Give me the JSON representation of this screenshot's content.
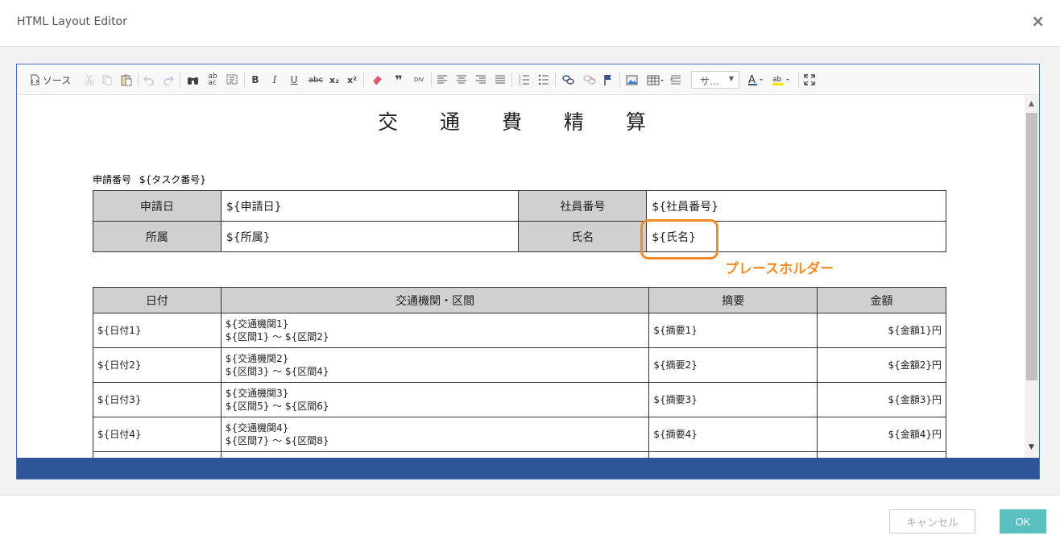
{
  "dialog": {
    "title": "HTML Layout Editor",
    "close_glyph": "×",
    "cancel_label": "キャンセル",
    "ok_label": "OK"
  },
  "colors": {
    "accent_blue": "#2d5597",
    "highlight_orange": "#f28c28",
    "ok_button": "#5bc0c0"
  },
  "toolbar": {
    "source_label": "ソース",
    "format_select_value": "サ…",
    "buttons": [
      "source-button",
      "cut-button",
      "copy-button",
      "paste-button",
      "undo-button",
      "redo-button",
      "find-button",
      "replace-button",
      "select-all-button",
      "bold-button",
      "italic-button",
      "underline-button",
      "strikethrough-button",
      "subscript-button",
      "superscript-button",
      "remove-format-button",
      "blockquote-button",
      "div-button",
      "align-left-button",
      "align-center-button",
      "align-right-button",
      "justify-button",
      "numbered-list-button",
      "bulleted-list-button",
      "link-button",
      "unlink-button",
      "anchor-button",
      "image-button",
      "table-button",
      "hr-button",
      "format-select",
      "text-color-button",
      "bg-color-button",
      "maximize-button"
    ],
    "labels": {
      "bold": "B",
      "italic": "I",
      "underline": "U",
      "strike": "abc",
      "sub": "x₂",
      "sup": "x²",
      "quote": "❞",
      "div": "DIV"
    }
  },
  "document": {
    "title": "交 通 費 精 算",
    "request_no_label": "申請番号",
    "request_no_value": "${タスク番号}",
    "info_table": [
      {
        "label1": "申請日",
        "value1": "${申請日}",
        "label2": "社員番号",
        "value2": "${社員番号}"
      },
      {
        "label1": "所属",
        "value1": "${所属}",
        "label2": "氏名",
        "value2": "${氏名}"
      }
    ],
    "detail_headers": [
      "日付",
      "交通機関・区間",
      "摘要",
      "金額"
    ],
    "detail_rows": [
      {
        "date": "${日付1}",
        "transport": "${交通機関1}",
        "section": "${区間1} ～ ${区間2}",
        "note": "${摘要1}",
        "amount": "${金額1}円"
      },
      {
        "date": "${日付2}",
        "transport": "${交通機関2}",
        "section": "${区間3} ～ ${区間4}",
        "note": "${摘要2}",
        "amount": "${金額2}円"
      },
      {
        "date": "${日付3}",
        "transport": "${交通機関3}",
        "section": "${区間5} ～ ${区間6}",
        "note": "${摘要3}",
        "amount": "${金額3}円"
      },
      {
        "date": "${日付4}",
        "transport": "${交通機関4}",
        "section": "${区間7} ～ ${区間8}",
        "note": "${摘要4}",
        "amount": "${金額4}円"
      }
    ]
  },
  "annotation": {
    "label": "プレースホルダー"
  }
}
